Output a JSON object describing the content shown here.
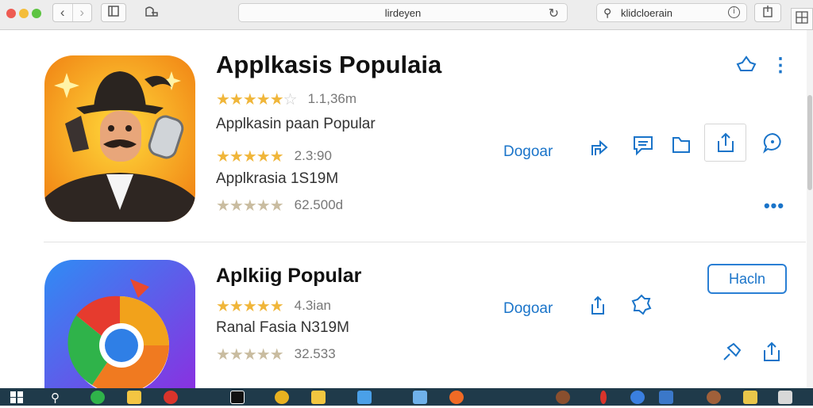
{
  "browser": {
    "address_text": "lirdeyen",
    "search_text": "klidcloerain",
    "back_icon": "chevron-left-icon",
    "forward_icon": "chevron-right-icon",
    "reload_icon": "reload-icon"
  },
  "apps": [
    {
      "title": "Applkasis Populaia",
      "rating1": "1.1,36m",
      "subtitle1": "Applkasin paan Popular",
      "rating2": "2.3:90",
      "subtitle2": "Applkrasia 1S19M",
      "rating3": "62.500d",
      "get_label": "Dogoar"
    },
    {
      "title": "Aplkiig Popular",
      "rating1": "4.3ian",
      "subtitle1": "Ranal Fasia N319M",
      "rating2": "32.533",
      "get_label": "Dogoar",
      "action_label": "Hacln"
    }
  ],
  "colors": {
    "accent": "#1a74c9",
    "star": "#f0b63a",
    "taskbar": "#1f3a4a"
  }
}
